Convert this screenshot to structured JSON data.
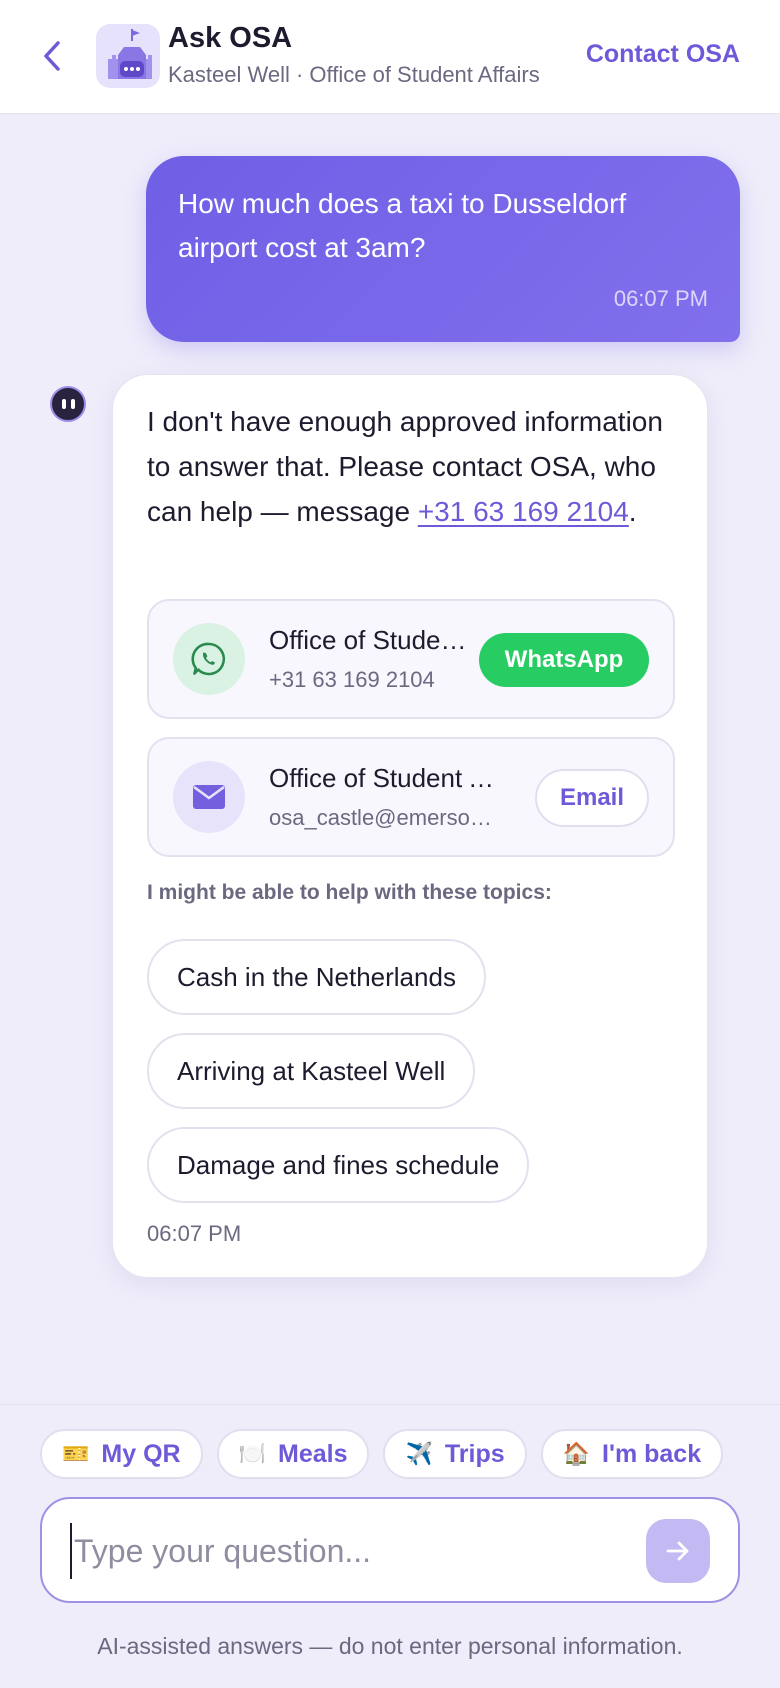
{
  "header": {
    "title": "Ask OSA",
    "subtitle": "Kasteel Well · Office of Student Affairs",
    "contact_label": "Contact OSA",
    "back_icon": "chevron-left-icon",
    "avatar_icon": "castle-chat-icon"
  },
  "messages": {
    "user": {
      "text": "How much does a taxi to Dusseldorf airport cost at 3am?",
      "time": "06:07 PM"
    },
    "bot": {
      "text_before": "I don't have enough approved information to answer that. Please contact OSA, who can help — message ",
      "phone_link": "+31 63 169 2104",
      "text_after": ".",
      "time": "06:07 PM",
      "contacts": [
        {
          "name": "Office of Student Affairs",
          "detail": "+31 63 169 2104",
          "action": "WhatsApp",
          "icon": "whatsapp-icon"
        },
        {
          "name": "Office of Student Affairs",
          "detail": "osa_castle@emerson.edu",
          "action": "Email",
          "icon": "mail-icon"
        }
      ],
      "topics_label": "I might be able to help with these topics:",
      "topics": [
        "Cash in the Netherlands",
        "Arriving at Kasteel Well",
        "Damage and fines schedule"
      ]
    }
  },
  "quick_actions": [
    {
      "label": "My QR",
      "emoji": "🎫"
    },
    {
      "label": "Meals",
      "emoji": "🍽️"
    },
    {
      "label": "Trips",
      "emoji": "✈️"
    },
    {
      "label": "I'm back",
      "emoji": "🏠"
    }
  ],
  "composer": {
    "placeholder": "Type your question...",
    "disclaimer": "AI-assisted answers — do not enter personal information.",
    "send_icon": "arrow-right-icon"
  },
  "colors": {
    "accent": "#6e5ad8",
    "user_bubble": "#7462e8",
    "whatsapp": "#27cc63",
    "background": "#efedfa"
  }
}
